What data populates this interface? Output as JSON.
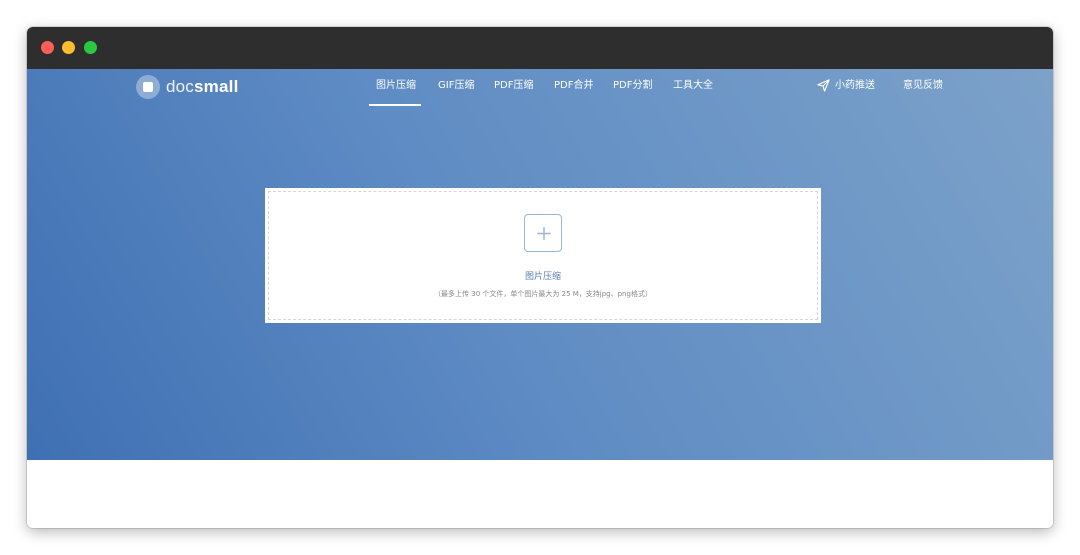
{
  "logo": {
    "part1": "doc",
    "part2": "small"
  },
  "nav": {
    "items": [
      {
        "label": "图片压缩",
        "active": true
      },
      {
        "label": "GIF压缩"
      },
      {
        "label": "PDF压缩"
      },
      {
        "label": "PDF合并"
      },
      {
        "label": "PDF分割"
      },
      {
        "label": "工具大全"
      }
    ],
    "right": {
      "push_label": "小药推送",
      "feedback_label": "意见反馈",
      "push_icon": "send-icon"
    }
  },
  "upload": {
    "title": "图片压缩",
    "hint": "（最多上传 30 个文件，单个图片最大为 25 M，支持jpg、png格式）",
    "icon": "plus-icon"
  },
  "colors": {
    "hero_gradient_start": "#3f70b3",
    "hero_gradient_end": "#7ca2c9",
    "accent": "#5c7fb3",
    "titlebar": "#2e2e2e"
  }
}
